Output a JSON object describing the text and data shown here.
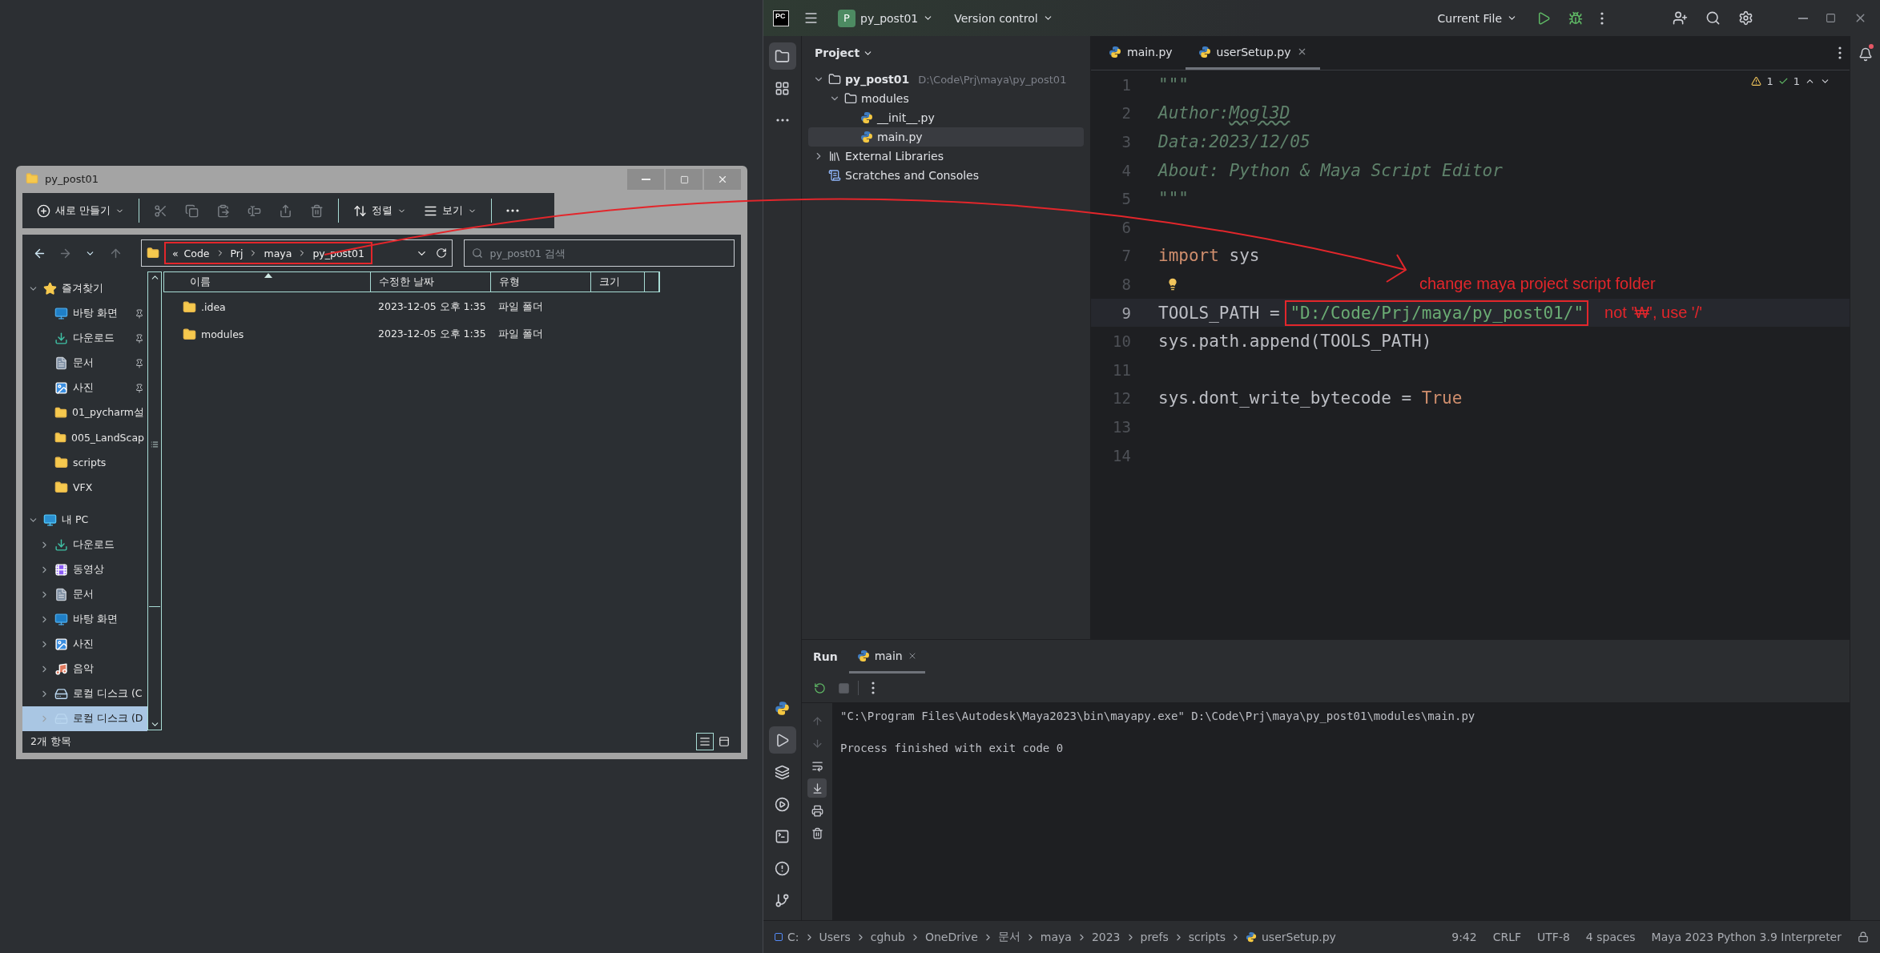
{
  "explorer": {
    "title": "py_post01",
    "toolbar": [
      {
        "kind": "new",
        "label": "새로 만들기",
        "disabled": false
      },
      {
        "kind": "cut",
        "disabled": true
      },
      {
        "kind": "copy",
        "disabled": true
      },
      {
        "kind": "paste",
        "disabled": true
      },
      {
        "kind": "rename",
        "disabled": true
      },
      {
        "kind": "share",
        "disabled": true
      },
      {
        "kind": "delete",
        "disabled": true
      },
      {
        "kind": "sort",
        "label": "정렬",
        "disabled": false
      },
      {
        "kind": "view",
        "label": "보기",
        "disabled": false
      },
      {
        "kind": "more",
        "disabled": false
      }
    ],
    "address": {
      "overflow": "«",
      "crumbs": [
        "Code",
        "Prj",
        "maya",
        "py_post01"
      ],
      "marked": true
    },
    "search": {
      "placeholder": "py_post01 검색"
    },
    "nav": [
      {
        "label": "즐겨찾기",
        "kind": "star",
        "expanded": true,
        "selected": false,
        "children": [
          {
            "label": "바탕 화면",
            "kind": "desktop",
            "pinned": true,
            "selected": false
          },
          {
            "label": "다운로드",
            "kind": "download",
            "pinned": true,
            "selected": false
          },
          {
            "label": "문서",
            "kind": "document",
            "pinned": true,
            "selected": false
          },
          {
            "label": "사진",
            "kind": "picture",
            "pinned": true,
            "selected": false
          },
          {
            "label": "01_pycharm설",
            "kind": "folder",
            "pinned": false,
            "selected": false
          },
          {
            "label": "005_LandScap",
            "kind": "folder",
            "pinned": false,
            "selected": false
          },
          {
            "label": "scripts",
            "kind": "folder",
            "pinned": false,
            "selected": false
          },
          {
            "label": "VFX",
            "kind": "folder",
            "pinned": false,
            "selected": false
          }
        ]
      },
      {
        "label": "내 PC",
        "kind": "pc",
        "expanded": true,
        "selected": false,
        "children": [
          {
            "label": "다운로드",
            "kind": "download",
            "expanded": false,
            "selected": false
          },
          {
            "label": "동영상",
            "kind": "video",
            "expanded": false,
            "selected": false
          },
          {
            "label": "문서",
            "kind": "document",
            "expanded": false,
            "selected": false
          },
          {
            "label": "바탕 화면",
            "kind": "desktop",
            "expanded": false,
            "selected": false
          },
          {
            "label": "사진",
            "kind": "picture",
            "expanded": false,
            "selected": false
          },
          {
            "label": "음악",
            "kind": "music",
            "expanded": false,
            "selected": false
          },
          {
            "label": "로컬 디스크 (C",
            "kind": "disk",
            "expanded": false,
            "selected": false
          },
          {
            "label": "로컬 디스크 (D",
            "kind": "disk",
            "expanded": false,
            "selected": true
          }
        ]
      }
    ],
    "columns": [
      "이름",
      "수정한 날짜",
      "유형",
      "크기"
    ],
    "rows": [
      {
        "name": ".idea",
        "date": "2023-12-05 오후 1:35",
        "type": "파일 폴더"
      },
      {
        "name": "modules",
        "date": "2023-12-05 오후 1:35",
        "type": "파일 폴더"
      }
    ],
    "status": "2개 항목",
    "views": [
      {
        "kind": "details",
        "selected": true
      },
      {
        "kind": "tiles",
        "selected": false
      }
    ]
  },
  "ide": {
    "logo": "PC",
    "project_badge": "P",
    "project": "py_post01",
    "vcs": "Version control",
    "run_config": "Current File",
    "left_tools": [
      {
        "kind": "project",
        "selected": true
      },
      {
        "kind": "structure",
        "selected": false
      },
      {
        "kind": "more",
        "selected": false
      }
    ],
    "bottom_tools": [
      {
        "kind": "python",
        "selected": false
      },
      {
        "kind": "run",
        "selected": true
      },
      {
        "kind": "layers",
        "selected": false
      },
      {
        "kind": "services",
        "selected": false
      },
      {
        "kind": "terminal",
        "selected": false
      },
      {
        "kind": "problems",
        "selected": false
      },
      {
        "kind": "git",
        "selected": false
      }
    ],
    "project_pane": {
      "title": "Project",
      "tree": [
        {
          "label": "py_post01",
          "path": "D:\\Code\\Prj\\maya\\py_post01",
          "kind": "root",
          "expanded": true,
          "selected": false,
          "children": [
            {
              "label": "modules",
              "kind": "package",
              "expanded": true,
              "selected": false,
              "children": [
                {
                  "label": "__init__.py",
                  "kind": "python",
                  "selected": false
                },
                {
                  "label": "main.py",
                  "kind": "python",
                  "selected": true
                }
              ]
            }
          ]
        },
        {
          "label": "External Libraries",
          "kind": "library",
          "expanded": false,
          "selected": false
        },
        {
          "label": "Scratches and Consoles",
          "kind": "scratch",
          "selected": false
        }
      ]
    },
    "tabs": [
      {
        "label": "main.py",
        "selected": false
      },
      {
        "label": "userSetup.py",
        "selected": true
      }
    ],
    "inspections": {
      "warnings": "1",
      "passed": "1"
    },
    "code": [
      {
        "n": "1",
        "current": false,
        "hint": false,
        "tokens": [
          {
            "kind": "doc",
            "text": "\"\"\""
          }
        ]
      },
      {
        "n": "2",
        "current": false,
        "hint": false,
        "tokens": [
          {
            "kind": "doc",
            "text": "Author:"
          },
          {
            "kind": "doc_typo",
            "text": "Mogl3D"
          }
        ]
      },
      {
        "n": "3",
        "current": false,
        "hint": false,
        "tokens": [
          {
            "kind": "doc",
            "text": "Data:2023/12/05"
          }
        ]
      },
      {
        "n": "4",
        "current": false,
        "hint": false,
        "tokens": [
          {
            "kind": "doc",
            "text": "About: Python & Maya Script Editor"
          }
        ]
      },
      {
        "n": "5",
        "current": false,
        "hint": false,
        "tokens": [
          {
            "kind": "doc",
            "text": "\"\"\""
          }
        ]
      },
      {
        "n": "6",
        "current": false,
        "hint": false
      },
      {
        "n": "7",
        "current": false,
        "hint": false,
        "tokens": [
          {
            "kind": "keyword",
            "text": "import"
          },
          {
            "kind": "plain",
            "text": " sys"
          }
        ]
      },
      {
        "n": "8",
        "current": false,
        "hint": true,
        "annotation": "change maya project script folder"
      },
      {
        "n": "9",
        "current": true,
        "hint": false,
        "tokens": [
          {
            "kind": "plain",
            "text": "TOOLS_PATH = "
          },
          {
            "kind": "string",
            "text": "\"D:/Code/Prj/maya/py_post01/\"",
            "marked": true
          }
        ],
        "annotation": "not '₩', use '/'"
      },
      {
        "n": "10",
        "current": false,
        "hint": false,
        "tokens": [
          {
            "kind": "plain",
            "text": "sys.path.append(TOOLS_PATH)"
          }
        ]
      },
      {
        "n": "11",
        "current": false,
        "hint": false
      },
      {
        "n": "12",
        "current": false,
        "hint": false,
        "tokens": [
          {
            "kind": "plain",
            "text": "sys.dont_write_bytecode = "
          },
          {
            "kind": "keyword",
            "text": "True"
          }
        ]
      },
      {
        "n": "13",
        "current": false,
        "hint": false
      },
      {
        "n": "14",
        "current": false,
        "hint": false
      }
    ],
    "run": {
      "title": "Run",
      "tabs": [
        {
          "label": "main",
          "selected": true
        }
      ],
      "toolbar": [
        {
          "kind": "rerun",
          "disabled": false
        },
        {
          "kind": "stop",
          "disabled": true
        },
        {
          "kind": "more",
          "disabled": false
        }
      ],
      "side_tools": [
        {
          "kind": "up",
          "disabled": true,
          "selected": false
        },
        {
          "kind": "down",
          "disabled": true,
          "selected": false
        },
        {
          "kind": "wrap",
          "disabled": false,
          "selected": false
        },
        {
          "kind": "scroll_end",
          "disabled": false,
          "selected": true
        },
        {
          "kind": "print",
          "disabled": false,
          "selected": false
        },
        {
          "kind": "clear",
          "disabled": false,
          "selected": false
        }
      ],
      "output": [
        {
          "kind": "command",
          "text": "\"C:\\Program Files\\Autodesk\\Maya2023\\bin\\mayapy.exe\" D:\\Code\\Prj\\maya\\py_post01\\modules\\main.py"
        },
        {
          "kind": "result",
          "text": "Process finished with exit code 0"
        }
      ]
    },
    "status": {
      "path": [
        "C:",
        "Users",
        "cghub",
        "OneDrive",
        "문서",
        "maya",
        "2023",
        "prefs",
        "scripts",
        "userSetup.py"
      ],
      "items": [
        "9:42",
        "CRLF",
        "UTF-8",
        "4 spaces",
        "Maya 2023 Python 3.9 Interpreter"
      ]
    }
  }
}
